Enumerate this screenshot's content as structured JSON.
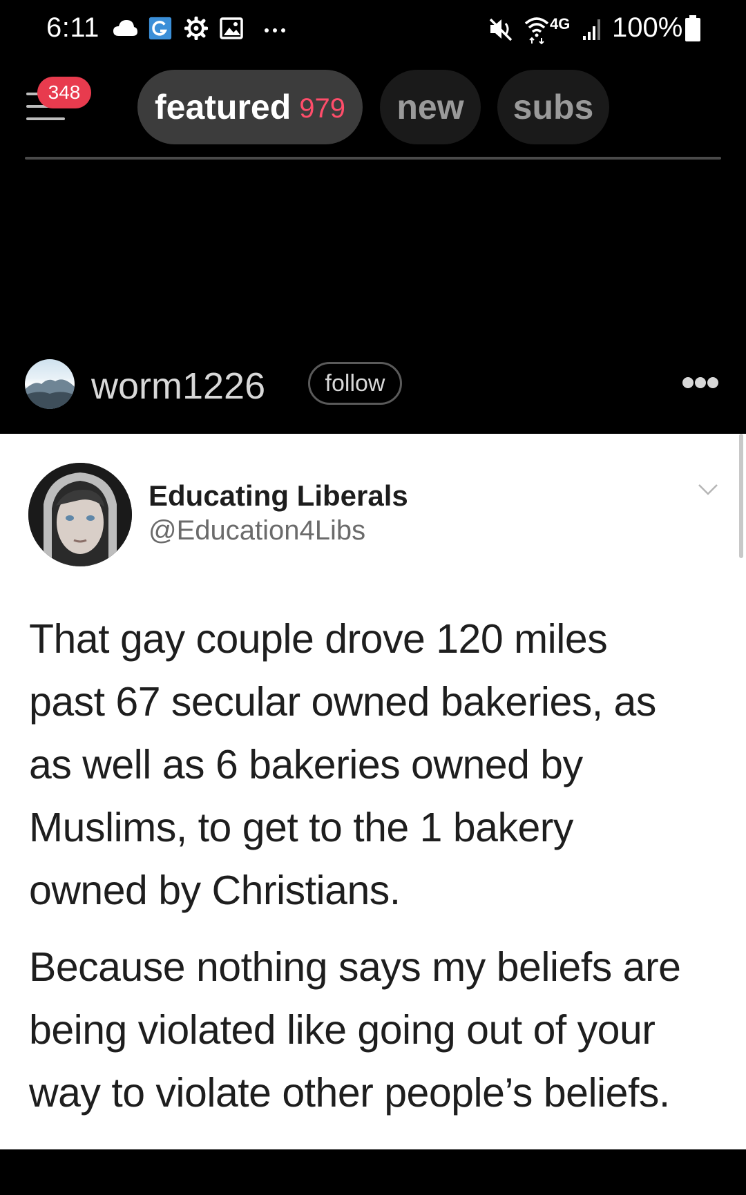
{
  "status_bar": {
    "time": "6:11",
    "battery": "100%",
    "network": "4G",
    "icons": [
      "cloud-icon",
      "g-app-icon",
      "settings-gear-icon",
      "gallery-icon",
      "more-dots-icon",
      "mute-icon",
      "wifi-icon",
      "signal-icon",
      "battery-icon"
    ]
  },
  "nav": {
    "notification_count": "348",
    "tabs": [
      {
        "label": "featured",
        "count": "979",
        "active": true
      },
      {
        "label": "new",
        "active": false
      },
      {
        "label": "subs",
        "active": false
      }
    ]
  },
  "post": {
    "username": "worm1226",
    "follow_label": "follow"
  },
  "tweet": {
    "name": "Educating Liberals",
    "handle": "@Education4Libs",
    "paragraph1": "That gay couple drove 120 miles\npast 67 secular owned bakeries, as\nas well as 6 bakeries owned by\nMuslims, to get to the 1 bakery\nowned by Christians.",
    "paragraph2": "Because nothing says my beliefs are\nbeing violated like going out of your\nway to violate other people’s beliefs."
  },
  "colors": {
    "background": "#000000",
    "badge": "#e83b4e",
    "tab_count": "#ff4d6a",
    "active_tab": "#3c3c3c",
    "inactive_tab": "#1a1a1a"
  }
}
